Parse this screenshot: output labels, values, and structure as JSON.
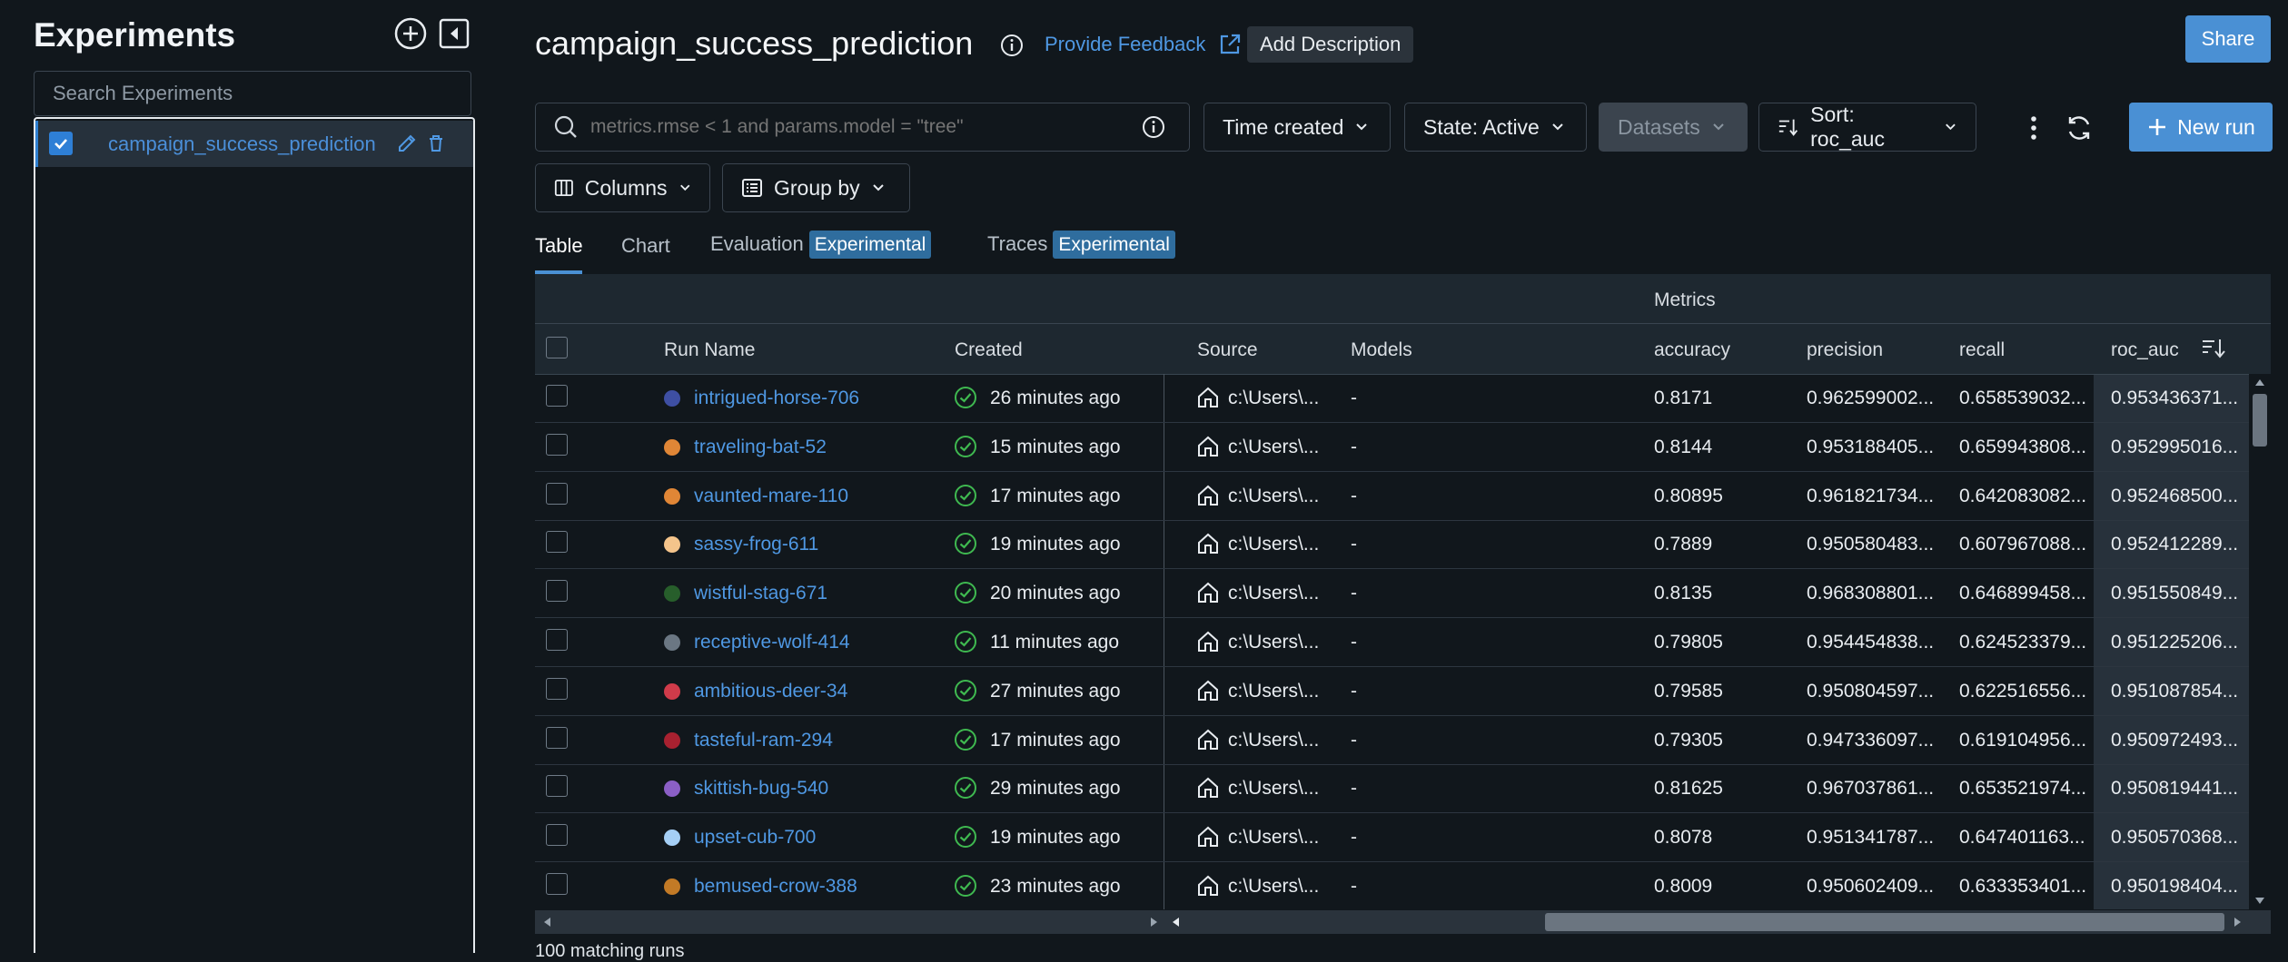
{
  "sidebar": {
    "title": "Experiments",
    "search_placeholder": "Search Experiments",
    "experiments": [
      {
        "name": "campaign_success_prediction",
        "checked": true
      }
    ]
  },
  "header": {
    "title": "campaign_success_prediction",
    "feedback_label": "Provide Feedback",
    "add_description_label": "Add Description",
    "share_label": "Share"
  },
  "toolbar": {
    "search_placeholder": "metrics.rmse < 1 and params.model = \"tree\"",
    "time_created_label": "Time created",
    "state_label": "State: Active",
    "datasets_label": "Datasets",
    "sort_label": "Sort: roc_auc",
    "new_run_label": "New run",
    "columns_label": "Columns",
    "group_by_label": "Group by"
  },
  "tabs": [
    {
      "label": "Table",
      "active": true
    },
    {
      "label": "Chart"
    },
    {
      "label": "Evaluation",
      "badge": "Experimental"
    },
    {
      "label": "Traces",
      "badge": "Experimental"
    }
  ],
  "table": {
    "group_header": "Metrics",
    "columns": [
      "Run Name",
      "Created",
      "Source",
      "Models",
      "accuracy",
      "precision",
      "recall",
      "roc_auc"
    ],
    "rows": [
      {
        "name": "intrigued-horse-706",
        "color": "#3e4fa3",
        "created": "26 minutes ago",
        "source": "c:\\Users\\...",
        "models": "-",
        "accuracy": "0.8171",
        "precision": "0.962599002...",
        "recall": "0.658539032...",
        "roc_auc": "0.953436371..."
      },
      {
        "name": "traveling-bat-52",
        "color": "#e08636",
        "created": "15 minutes ago",
        "source": "c:\\Users\\...",
        "models": "-",
        "accuracy": "0.8144",
        "precision": "0.953188405...",
        "recall": "0.659943808...",
        "roc_auc": "0.952995016..."
      },
      {
        "name": "vaunted-mare-110",
        "color": "#e08636",
        "created": "17 minutes ago",
        "source": "c:\\Users\\...",
        "models": "-",
        "accuracy": "0.80895",
        "precision": "0.961821734...",
        "recall": "0.642083082...",
        "roc_auc": "0.952468500..."
      },
      {
        "name": "sassy-frog-611",
        "color": "#f4c48b",
        "created": "19 minutes ago",
        "source": "c:\\Users\\...",
        "models": "-",
        "accuracy": "0.7889",
        "precision": "0.950580483...",
        "recall": "0.607967088...",
        "roc_auc": "0.952412289..."
      },
      {
        "name": "wistful-stag-671",
        "color": "#275e2b",
        "created": "20 minutes ago",
        "source": "c:\\Users\\...",
        "models": "-",
        "accuracy": "0.8135",
        "precision": "0.968308801...",
        "recall": "0.646899458...",
        "roc_auc": "0.951550849..."
      },
      {
        "name": "receptive-wolf-414",
        "color": "#6b7783",
        "created": "11 minutes ago",
        "source": "c:\\Users\\...",
        "models": "-",
        "accuracy": "0.79805",
        "precision": "0.954454838...",
        "recall": "0.624523379...",
        "roc_auc": "0.951225206..."
      },
      {
        "name": "ambitious-deer-34",
        "color": "#d03b4a",
        "created": "27 minutes ago",
        "source": "c:\\Users\\...",
        "models": "-",
        "accuracy": "0.79585",
        "precision": "0.950804597...",
        "recall": "0.622516556...",
        "roc_auc": "0.951087854..."
      },
      {
        "name": "tasteful-ram-294",
        "color": "#a82130",
        "created": "17 minutes ago",
        "source": "c:\\Users\\...",
        "models": "-",
        "accuracy": "0.79305",
        "precision": "0.947336097...",
        "recall": "0.619104956...",
        "roc_auc": "0.950972493..."
      },
      {
        "name": "skittish-bug-540",
        "color": "#8b5fc6",
        "created": "29 minutes ago",
        "source": "c:\\Users\\...",
        "models": "-",
        "accuracy": "0.81625",
        "precision": "0.967037861...",
        "recall": "0.653521974...",
        "roc_auc": "0.950819441..."
      },
      {
        "name": "upset-cub-700",
        "color": "#a5cff5",
        "created": "19 minutes ago",
        "source": "c:\\Users\\...",
        "models": "-",
        "accuracy": "0.8078",
        "precision": "0.951341787...",
        "recall": "0.647401163...",
        "roc_auc": "0.950570368..."
      },
      {
        "name": "bemused-crow-388",
        "color": "#c27a26",
        "created": "23 minutes ago",
        "source": "c:\\Users\\...",
        "models": "-",
        "accuracy": "0.8009",
        "precision": "0.950602409...",
        "recall": "0.633353401...",
        "roc_auc": "0.950198404..."
      }
    ]
  },
  "footer": {
    "matching_runs": "100 matching runs"
  },
  "colors": {
    "accent": "#4a90d4",
    "link": "#4f98e3",
    "success": "#3fb950",
    "background": "#11171c"
  }
}
